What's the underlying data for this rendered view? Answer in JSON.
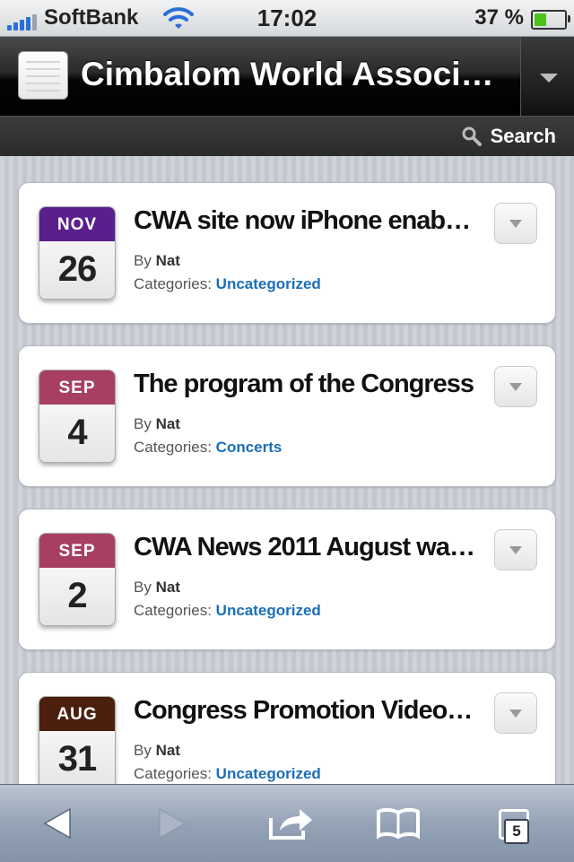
{
  "status_bar": {
    "carrier": "SoftBank",
    "time": "17:02",
    "battery_percent": "37 %",
    "battery_level": 0.37
  },
  "header": {
    "site_title": "Cimbalom World Associati…",
    "search_label": "Search"
  },
  "posts": [
    {
      "month": "NOV",
      "day": "26",
      "month_color": "#5a1f8a",
      "title": "CWA site now iPhone enabled",
      "by_label": "By",
      "author": "Nat",
      "categories_label": "Categories:",
      "category": "Uncategorized"
    },
    {
      "month": "SEP",
      "day": "4",
      "month_color": "#a63f63",
      "title": "The program of the Congress",
      "by_label": "By",
      "author": "Nat",
      "categories_label": "Categories:",
      "category": "Concerts"
    },
    {
      "month": "SEP",
      "day": "2",
      "month_color": "#a63f63",
      "title": "CWA News 2011 August wa…",
      "by_label": "By",
      "author": "Nat",
      "categories_label": "Categories:",
      "category": "Uncategorized"
    },
    {
      "month": "AUG",
      "day": "31",
      "month_color": "#4a1f0d",
      "title": "Congress Promotion Video …",
      "by_label": "By",
      "author": "Nat",
      "categories_label": "Categories:",
      "category": "Uncategorized"
    }
  ],
  "toolbar": {
    "back_icon": "back-arrow-icon",
    "forward_icon": "forward-arrow-icon",
    "share_icon": "share-icon",
    "bookmarks_icon": "bookmarks-icon",
    "tabs_icon": "tabs-icon",
    "tab_count": "5"
  }
}
